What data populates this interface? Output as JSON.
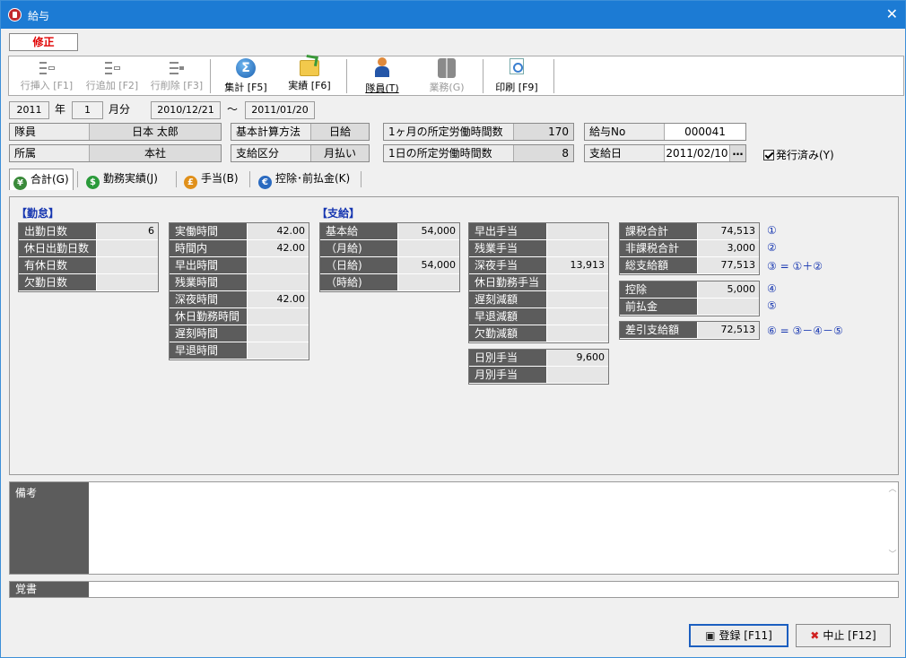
{
  "window": {
    "title": "給与",
    "close": "✕"
  },
  "mode": "修正",
  "toolbar": {
    "insert": "行挿入 [F1]",
    "add": "行追加 [F2]",
    "delete": "行削除 [F3]",
    "sum": "集計 [F5]",
    "actual": "実績 [F6]",
    "staff": "隊員(T)",
    "work": "業務(G)",
    "print": "印刷 [F9]"
  },
  "period": {
    "year": "2011",
    "year_unit": "年",
    "month": "1",
    "month_unit": "月分",
    "from": "2010/12/21",
    "sep": "～",
    "to": "2011/01/20"
  },
  "info": {
    "staff_label": "隊員",
    "staff_value": "日本 太郎",
    "dept_label": "所属",
    "dept_value": "本社",
    "calc_label": "基本計算方法",
    "calc_value": "日給",
    "paytype_label": "支給区分",
    "paytype_value": "月払い",
    "month_hours_label": "1ヶ月の所定労働時間数",
    "month_hours_value": "170",
    "day_hours_label": "1日の所定労働時間数",
    "day_hours_value": "8",
    "payno_label": "給与No",
    "payno_value": "000041",
    "paydate_label": "支給日",
    "paydate_value": "2011/02/10",
    "issued_label": "発行済み(Y)"
  },
  "tabs": [
    "合計(G)",
    "勤務実績(J)",
    "手当(B)",
    "控除･前払金(K)"
  ],
  "attendance": {
    "header": "【勤怠】",
    "days": [
      {
        "k": "出勤日数",
        "v": "6"
      },
      {
        "k": "休日出勤日数",
        "v": ""
      },
      {
        "k": "有休日数",
        "v": ""
      },
      {
        "k": "欠勤日数",
        "v": ""
      }
    ],
    "hours": [
      {
        "k": "実働時間",
        "v": "42.00"
      },
      {
        "k": "時間内",
        "v": "42.00"
      },
      {
        "k": "早出時間",
        "v": ""
      },
      {
        "k": "残業時間",
        "v": ""
      },
      {
        "k": "深夜時間",
        "v": "42.00"
      },
      {
        "k": "休日勤務時間",
        "v": ""
      },
      {
        "k": "遅刻時間",
        "v": ""
      },
      {
        "k": "早退時間",
        "v": ""
      }
    ]
  },
  "pay": {
    "header": "【支給】",
    "base": [
      {
        "k": "基本給",
        "v": "54,000"
      },
      {
        "k": "（月給)",
        "v": ""
      },
      {
        "k": "（日給)",
        "v": "54,000"
      },
      {
        "k": "（時給)",
        "v": ""
      }
    ],
    "allow": [
      {
        "k": "早出手当",
        "v": ""
      },
      {
        "k": "残業手当",
        "v": ""
      },
      {
        "k": "深夜手当",
        "v": "13,913"
      },
      {
        "k": "休日勤務手当",
        "v": ""
      },
      {
        "k": "遅刻減額",
        "v": ""
      },
      {
        "k": "早退減額",
        "v": ""
      },
      {
        "k": "欠勤減額",
        "v": ""
      }
    ],
    "extra": [
      {
        "k": "日別手当",
        "v": "9,600"
      },
      {
        "k": "月別手当",
        "v": ""
      }
    ]
  },
  "totals": {
    "a": [
      {
        "k": "課税合計",
        "v": "74,513",
        "n": "①"
      },
      {
        "k": "非課税合計",
        "v": "3,000",
        "n": "②"
      },
      {
        "k": "総支給額",
        "v": "77,513",
        "n": "③ = ①＋②"
      }
    ],
    "b": [
      {
        "k": "控除",
        "v": "5,000",
        "n": "④"
      },
      {
        "k": "前払金",
        "v": "",
        "n": "⑤"
      }
    ],
    "c": [
      {
        "k": "差引支給額",
        "v": "72,513",
        "n": "⑥ = ③－④－⑤"
      }
    ]
  },
  "memo": {
    "remarks_label": "備考",
    "remarks": "",
    "note_label": "覚書",
    "note": ""
  },
  "buttons": {
    "save": "登録 [F11]",
    "cancel": "中止 [F12]"
  },
  "colors": {
    "titlebar": "#1c7bd4",
    "mode": "#e00000",
    "grid_key": "#5c5c5c",
    "note": "#1535b0"
  }
}
